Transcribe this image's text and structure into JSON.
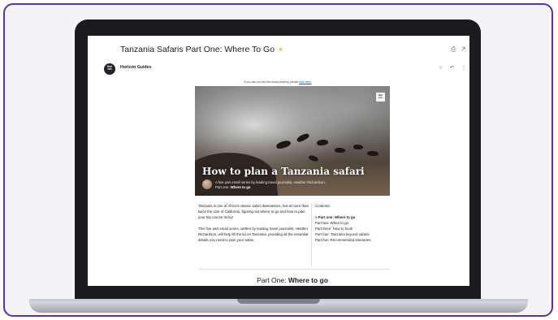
{
  "email": {
    "subject": "Tanzania Safaris Part One: Where To Go",
    "sender": "Horizon Guides",
    "avatar_text": [
      "Hori",
      "zon"
    ],
    "preheader": "If you can not see this email properly, please",
    "preheader_link": "click here."
  },
  "hero": {
    "logo_text": [
      "Hori",
      "zon"
    ],
    "title": "How to plan a Tanzania safari",
    "subtitle": "A five part email series by leading travel journalist, Heather Richardson.",
    "part_prefix": "Part one: ",
    "part_name": "Where to go"
  },
  "body": {
    "para1": "Tanzania is one of Africa's classic safari destinations, but at more than twice the size of California, figuring out where to go and how to plan your trip can be tricky!",
    "para2": "This five part email series, written by leading travel journalist, Heather Richardson, will help lift the lid on Tanzania, providing all the essential details you need to plan your safari."
  },
  "contents": {
    "heading": "Contents:",
    "items": [
      "> Part one: Where to go",
      "Part two: When to go",
      "Part three: How to book",
      "Part four: Tanzania beyond safaris",
      "Part five: Recommended itineraries"
    ]
  },
  "section": {
    "prefix": "Part One: ",
    "title": "Where to go"
  },
  "icons": {
    "important": "important-marker-icon",
    "print": "print-icon",
    "open_new": "open-in-new-window-icon",
    "star": "star-icon",
    "reply": "reply-icon",
    "more": "more-vert-icon"
  },
  "colors": {
    "frame_border": "#5b2fb3",
    "link": "#1a57c7",
    "important": "#f2c230"
  }
}
